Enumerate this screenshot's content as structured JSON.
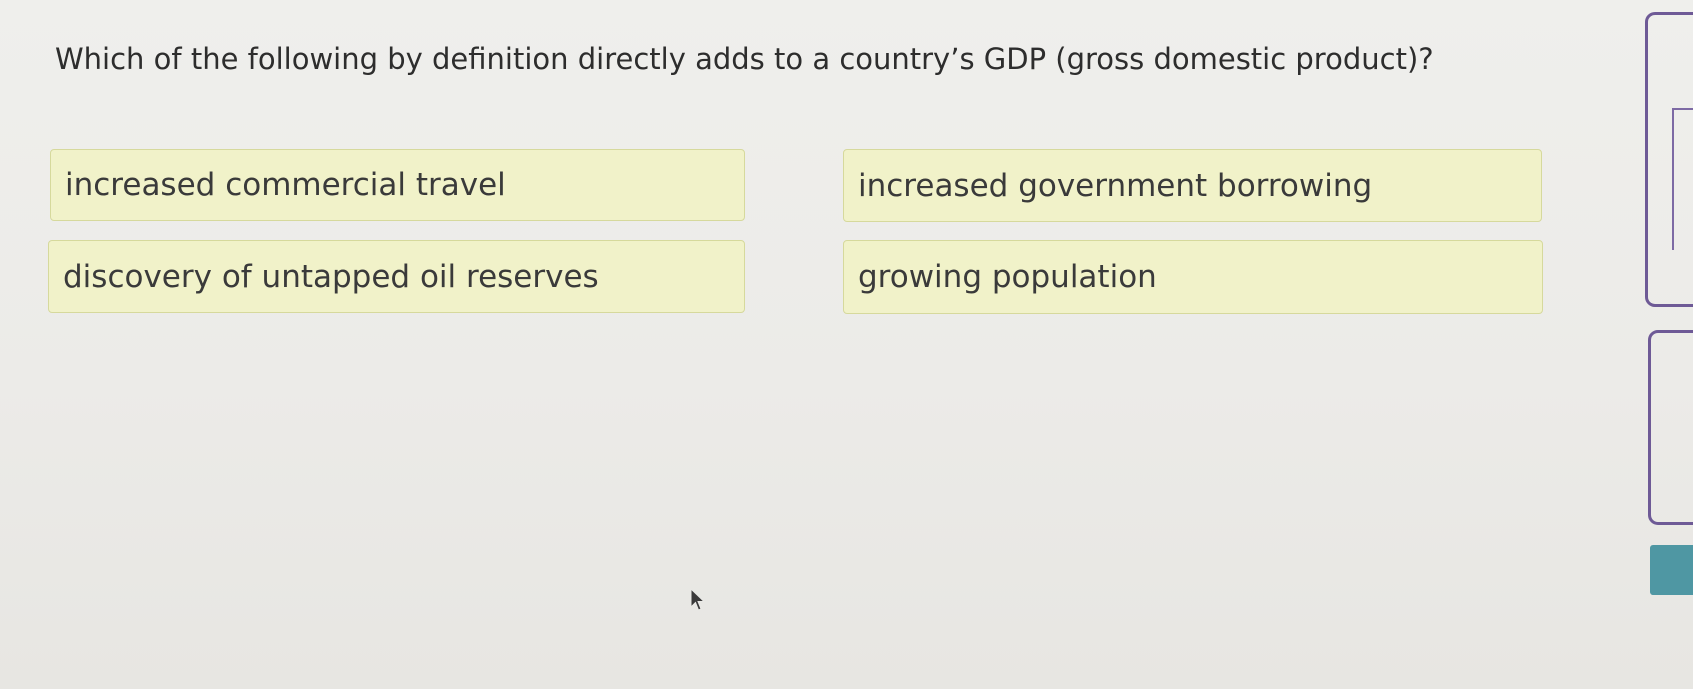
{
  "question": {
    "text": "Which of the following by definition directly adds to a country’s GDP (gross domestic product)?"
  },
  "options": [
    {
      "label": "increased commercial travel"
    },
    {
      "label": "increased government borrowing"
    },
    {
      "label": "discovery of untapped oil reserves"
    },
    {
      "label": "growing population"
    }
  ],
  "colors": {
    "option_background": "#f1f2c9",
    "option_border": "#d6d99c",
    "side_panel_border": "#6e5a96",
    "side_panel_button": "#4f97a3"
  },
  "icons": {
    "cursor": "mouse-pointer-icon"
  }
}
